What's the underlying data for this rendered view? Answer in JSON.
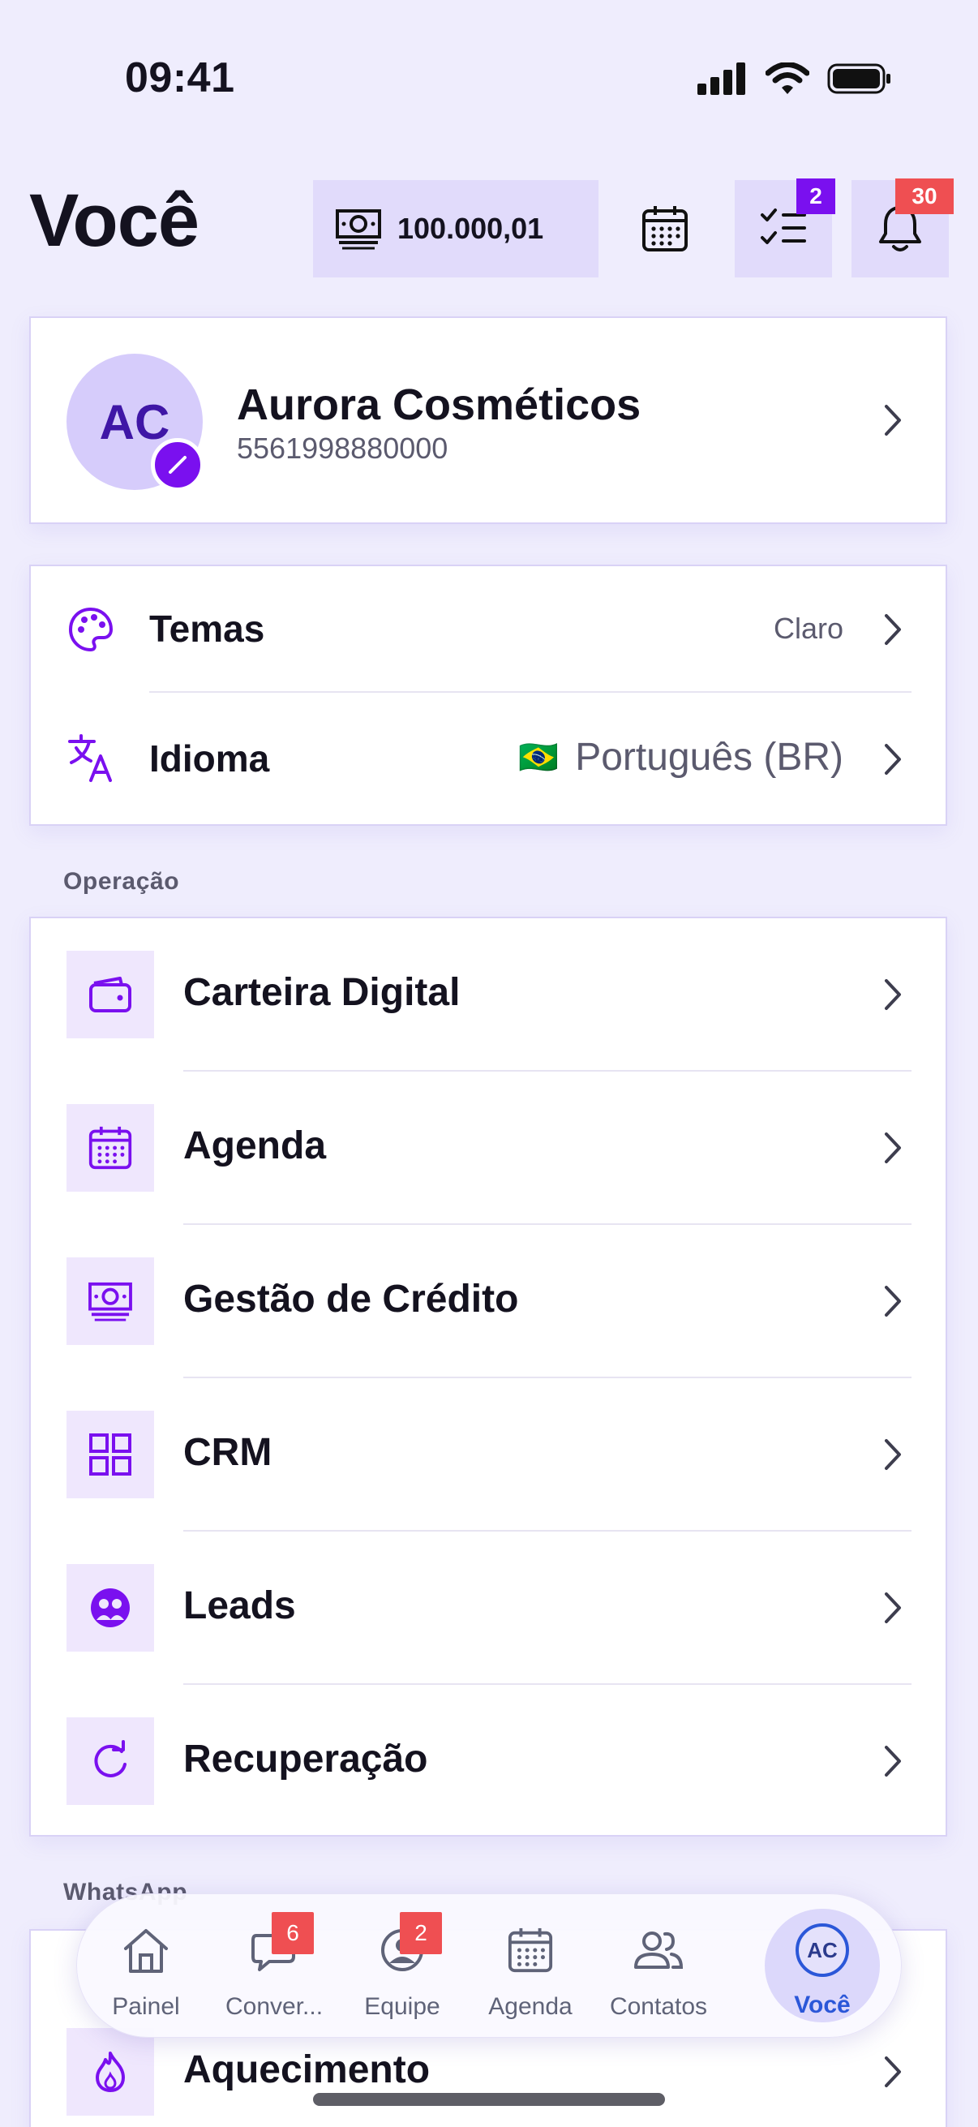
{
  "status": {
    "time": "09:41"
  },
  "header": {
    "title": "Você",
    "balance": "100.000,01",
    "tasks_badge": "2",
    "notifications_badge": "30"
  },
  "profile": {
    "initials": "AC",
    "name": "Aurora Cosméticos",
    "phone": "5561998880000"
  },
  "settings": {
    "theme_label": "Temas",
    "theme_value": "Claro",
    "language_label": "Idioma",
    "language_flag": "🇧🇷",
    "language_value": "Português (BR)"
  },
  "operation": {
    "section_title": "Operação",
    "items": [
      {
        "label": "Carteira Digital",
        "icon": "wallet-icon"
      },
      {
        "label": "Agenda",
        "icon": "calendar-icon"
      },
      {
        "label": "Gestão de Crédito",
        "icon": "money-icon"
      },
      {
        "label": "CRM",
        "icon": "grid-icon"
      },
      {
        "label": "Leads",
        "icon": "leads-icon"
      },
      {
        "label": "Recuperação",
        "icon": "refresh-icon"
      }
    ]
  },
  "whatsapp": {
    "section_title": "WhatsApp",
    "items": [
      {
        "label": "Aquecimento",
        "icon": "flame-icon"
      }
    ]
  },
  "tabbar": {
    "items": [
      {
        "label": "Painel",
        "icon": "home-icon"
      },
      {
        "label": "Conver...",
        "icon": "chat-icon",
        "badge": "6"
      },
      {
        "label": "Equipe",
        "icon": "team-icon",
        "badge": "2"
      },
      {
        "label": "Agenda",
        "icon": "calendar-icon"
      },
      {
        "label": "Contatos",
        "icon": "contacts-icon"
      },
      {
        "label": "Você",
        "icon": "avatar-icon",
        "initials": "AC"
      }
    ]
  },
  "colors": {
    "accent": "#7a10ef",
    "badge_red": "#ef4f52",
    "background": "#efedfd",
    "active_tab": "#2b57d8"
  }
}
